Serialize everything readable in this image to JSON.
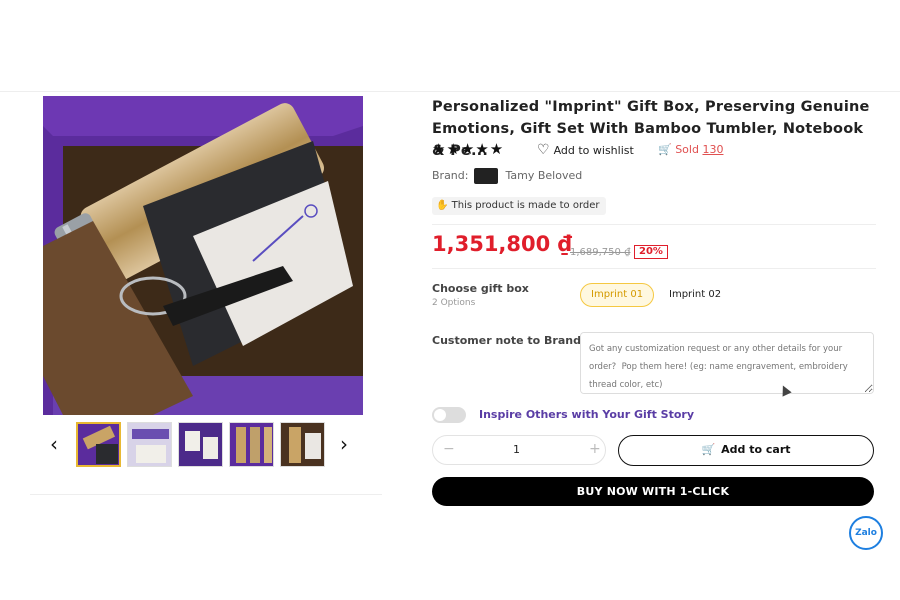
{
  "product": {
    "title": "Personalized \"Imprint\" Gift Box, Preserving Genuine Emotions, Gift Set With Bamboo Tumbler, Notebook & Pe...",
    "rating_stars": "★★★★★",
    "rating_value": 5,
    "wishlist_label": "Add to wishlist",
    "sold_label": "Sold",
    "sold_count": "130",
    "brand_label": "Brand:",
    "brand_name": "Tamy Beloved",
    "made_to_order": "This product is made to order",
    "price": "1,351,800 ₫",
    "old_price": "1,689,750 ₫",
    "discount": "20%",
    "gift_box": {
      "label": "Choose gift box",
      "count": "2 Options",
      "options": [
        "Imprint 01",
        "Imprint 02"
      ],
      "selected": "Imprint 01"
    },
    "note": {
      "label": "Customer note to Brand",
      "placeholder": "Got any customization request or any other details for your order?  Pop them here! (eg: name engravement, embroidery thread color, etc)"
    },
    "inspire_toggle": {
      "label": "Inspire Others with Your Gift Story",
      "on": false
    },
    "quantity": {
      "minus": "−",
      "value": "1",
      "plus": "+"
    },
    "add_to_cart": "Add to cart",
    "buy_now": "BUY NOW WITH 1-CLICK"
  },
  "gallery": {
    "thumb_count": 5,
    "active_index": 0,
    "prev_icon": "‹",
    "next_icon": "›"
  },
  "widgets": {
    "zalo_label": "Zalo"
  },
  "colors": {
    "price_red": "#e01e2b",
    "accent_yellow": "#f5c842",
    "inspire_purple": "#5a3da5",
    "buy_now_black": "#000000"
  }
}
